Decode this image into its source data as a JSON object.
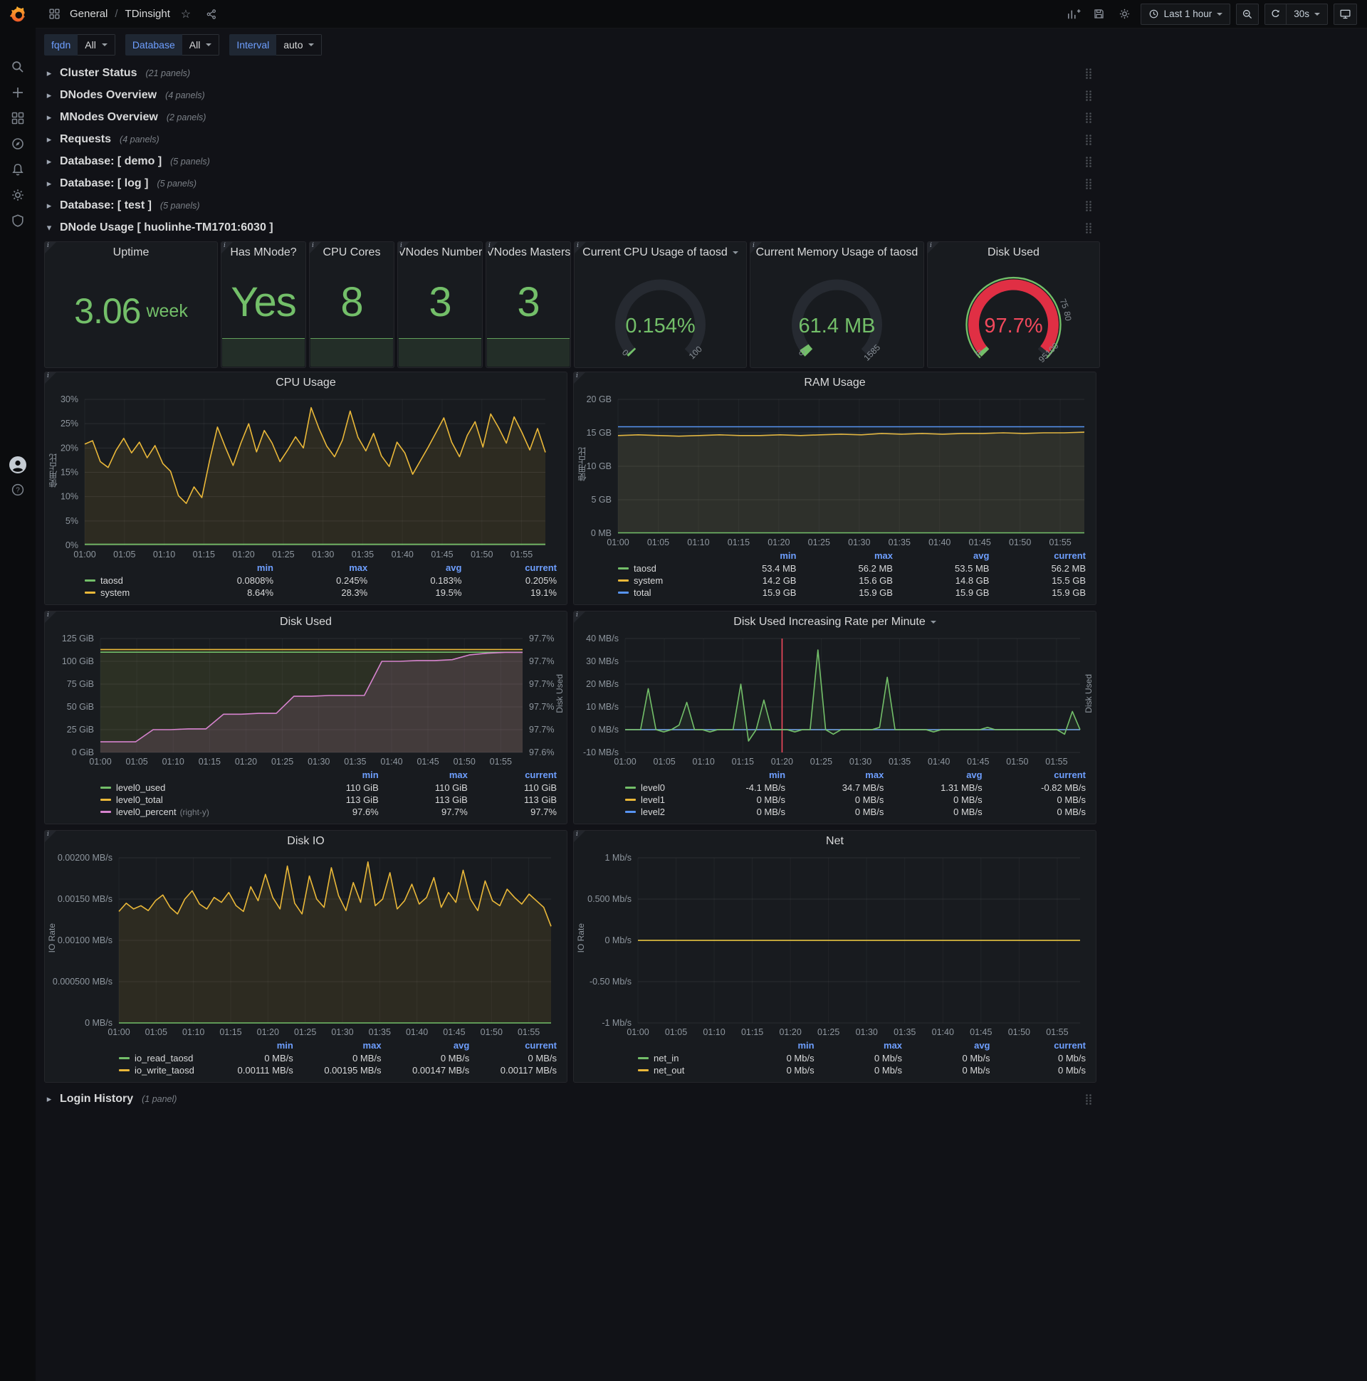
{
  "topbar": {
    "section": "General",
    "separator": "/",
    "page": "TDinsight",
    "time_range": "Last 1 hour",
    "refresh": "30s"
  },
  "variables": [
    {
      "label": "fqdn",
      "value": "All"
    },
    {
      "label": "Database",
      "value": "All"
    },
    {
      "label": "Interval",
      "value": "auto"
    }
  ],
  "rows": [
    {
      "title": "Cluster Status",
      "count": "(21 panels)"
    },
    {
      "title": "DNodes Overview",
      "count": "(4 panels)"
    },
    {
      "title": "MNodes Overview",
      "count": "(2 panels)"
    },
    {
      "title": "Requests",
      "count": "(4 panels)"
    },
    {
      "title": "Database: [ demo ]",
      "count": "(5 panels)"
    },
    {
      "title": "Database: [ log ]",
      "count": "(5 panels)"
    },
    {
      "title": "Database: [ test ]",
      "count": "(5 panels)"
    }
  ],
  "dnode_row": {
    "title": "DNode Usage [ huolinhe-TM1701:6030 ]"
  },
  "login_row": {
    "title": "Login History",
    "count": "(1 panel)"
  },
  "stats": [
    {
      "id": "uptime",
      "title": "Uptime",
      "value": "3.06",
      "suffix": "week",
      "sparkline": false
    },
    {
      "id": "has-mnode",
      "title": "Has MNode?",
      "value": "Yes",
      "suffix": "",
      "sparkline": true
    },
    {
      "id": "cpu-cores",
      "title": "CPU Cores",
      "value": "8",
      "suffix": "",
      "sparkline": true
    },
    {
      "id": "vnodes-number",
      "title": "VNodes Number",
      "value": "3",
      "suffix": "",
      "sparkline": true
    },
    {
      "id": "vnodes-masters",
      "title": "VNodes Masters",
      "value": "3",
      "suffix": "",
      "sparkline": true
    }
  ],
  "gauges": [
    {
      "id": "cpu-usage",
      "title": "Current CPU Usage of taosd",
      "caret": true,
      "value": "0.154%",
      "fraction": 0.00154,
      "min": "0",
      "max": "100",
      "color": "#73bf69",
      "thresholds": []
    },
    {
      "id": "mem-usage",
      "title": "Current Memory Usage of taosd",
      "caret": false,
      "value": "61.4 MB",
      "fraction": 0.0387,
      "min": "0",
      "max": "1585",
      "color": "#73bf69",
      "thresholds": []
    },
    {
      "id": "disk-used",
      "title": "Disk Used",
      "caret": false,
      "value": "97.7%",
      "fraction": 0.977,
      "min": "0",
      "max": "95100",
      "color": "#e02f44",
      "value_color": "#f2495c",
      "outer_ring": "#73bf69",
      "start_sliver": "#73bf69",
      "thresholds": [
        {
          "f": 0.75,
          "label": "75"
        },
        {
          "f": 0.8,
          "label": "80"
        }
      ]
    }
  ],
  "xticks": [
    "01:00",
    "01:05",
    "01:10",
    "01:15",
    "01:20",
    "01:25",
    "01:30",
    "01:35",
    "01:40",
    "01:45",
    "01:50",
    "01:55"
  ],
  "charts": [
    {
      "id": "cpu",
      "title": "CPU Usage",
      "caret": false,
      "ylabel": "使用占比",
      "ymin": 0,
      "ymax": 30,
      "yticks": [
        {
          "v": 0,
          "t": "0%"
        },
        {
          "v": 5,
          "t": "5%"
        },
        {
          "v": 10,
          "t": "10%"
        },
        {
          "v": 15,
          "t": "15%"
        },
        {
          "v": 20,
          "t": "20%"
        },
        {
          "v": 25,
          "t": "25%"
        },
        {
          "v": 30,
          "t": "30%"
        }
      ],
      "series": [
        {
          "name": "system",
          "color": "#eab839",
          "fill": 0.1,
          "data": [
            20.8,
            21.5,
            17.2,
            16.0,
            19.5,
            22.0,
            19.0,
            21.2,
            18.0,
            20.5,
            16.8,
            15.2,
            10.2,
            8.6,
            12.0,
            9.8,
            17.5,
            24.3,
            20.2,
            16.4,
            21.0,
            25.0,
            19.2,
            23.6,
            21.0,
            17.2,
            19.6,
            22.3,
            20.0,
            28.3,
            24.0,
            20.4,
            18.2,
            21.6,
            27.6,
            22.2,
            19.4,
            23.0,
            18.4,
            16.2,
            21.2,
            19.0,
            14.6,
            17.4,
            20.2,
            23.2,
            26.2,
            21.2,
            18.2,
            22.6,
            25.4,
            20.2,
            27.0,
            24.2,
            21.0,
            26.4,
            23.2,
            19.6,
            24.0,
            19.1
          ]
        },
        {
          "name": "taosd",
          "color": "#73bf69",
          "fill": 0.18,
          "data": [
            0.2,
            0.2
          ]
        }
      ],
      "legend": {
        "cols": [
          "min",
          "max",
          "avg",
          "current"
        ],
        "rows": [
          {
            "name": "taosd",
            "color": "#73bf69",
            "values": [
              "0.0808%",
              "0.245%",
              "0.183%",
              "0.205%"
            ]
          },
          {
            "name": "system",
            "color": "#eab839",
            "values": [
              "8.64%",
              "28.3%",
              "19.5%",
              "19.1%"
            ]
          }
        ]
      }
    },
    {
      "id": "ram",
      "title": "RAM Usage",
      "caret": false,
      "ylabel": "使用占比",
      "ymin": 0,
      "ymax": 20,
      "yticks": [
        {
          "v": 0,
          "t": "0 MB"
        },
        {
          "v": 5,
          "t": "5 GB"
        },
        {
          "v": 10,
          "t": "10 GB"
        },
        {
          "v": 15,
          "t": "15 GB"
        },
        {
          "v": 20,
          "t": "20 GB"
        }
      ],
      "series": [
        {
          "name": "system",
          "color": "#eab839",
          "fill": 0.1,
          "data": [
            14.6,
            14.7,
            14.6,
            14.5,
            14.6,
            14.7,
            14.6,
            14.6,
            14.7,
            14.6,
            14.7,
            14.8,
            14.7,
            14.9,
            14.8,
            14.9,
            14.8,
            14.9,
            14.9,
            15.0,
            14.9,
            15.0,
            15.0,
            15.1
          ]
        },
        {
          "name": "total",
          "color": "#5794f2",
          "fill": 0.05,
          "data": [
            15.9,
            15.9
          ]
        },
        {
          "name": "taosd",
          "color": "#73bf69",
          "fill": 0.15,
          "data": [
            0.055,
            0.055
          ]
        }
      ],
      "legend": {
        "cols": [
          "min",
          "max",
          "avg",
          "current"
        ],
        "rows": [
          {
            "name": "taosd",
            "color": "#73bf69",
            "values": [
              "53.4 MB",
              "56.2 MB",
              "53.5 MB",
              "56.2 MB"
            ]
          },
          {
            "name": "system",
            "color": "#eab839",
            "values": [
              "14.2 GB",
              "15.6 GB",
              "14.8 GB",
              "15.5 GB"
            ]
          },
          {
            "name": "total",
            "color": "#5794f2",
            "values": [
              "15.9 GB",
              "15.9 GB",
              "15.9 GB",
              "15.9 GB"
            ]
          }
        ]
      }
    },
    {
      "id": "disk",
      "title": "Disk Used",
      "caret": false,
      "right_label": "Disk Used",
      "ymin": 0,
      "ymax": 125,
      "yticks": [
        {
          "v": 0,
          "t": "0 GiB"
        },
        {
          "v": 25,
          "t": "25 GiB"
        },
        {
          "v": 50,
          "t": "50 GiB"
        },
        {
          "v": 75,
          "t": "75 GiB"
        },
        {
          "v": 100,
          "t": "100 GiB"
        },
        {
          "v": 125,
          "t": "125 GiB"
        }
      ],
      "right": {
        "min": 97.58,
        "max": 97.72,
        "ticks": [
          "97.6%",
          "97.7%",
          "97.7%",
          "97.7%",
          "97.7%",
          "97.7%"
        ]
      },
      "series": [
        {
          "name": "level0_total",
          "color": "#eab839",
          "fill": 0.07,
          "data": [
            113,
            113
          ]
        },
        {
          "name": "level0_used",
          "color": "#73bf69",
          "fill": 0.07,
          "data": [
            110,
            110
          ]
        },
        {
          "name": "level0_percent",
          "color": "#d683ce",
          "axis": "right",
          "fill": 0.14,
          "data": [
            97.593,
            97.593,
            97.593,
            97.608,
            97.608,
            97.609,
            97.609,
            97.627,
            97.627,
            97.628,
            97.628,
            97.649,
            97.649,
            97.65,
            97.65,
            97.65,
            97.692,
            97.692,
            97.693,
            97.693,
            97.694,
            97.7,
            97.702,
            97.703,
            97.703
          ]
        }
      ],
      "legend": {
        "cols": [
          "min",
          "max",
          "current"
        ],
        "rows": [
          {
            "name": "level0_used",
            "color": "#73bf69",
            "values": [
              "110 GiB",
              "110 GiB",
              "110 GiB"
            ]
          },
          {
            "name": "level0_total",
            "color": "#eab839",
            "values": [
              "113 GiB",
              "113 GiB",
              "113 GiB"
            ]
          },
          {
            "name": "level0_percent",
            "suffix": "(right-y)",
            "color": "#d683ce",
            "values": [
              "97.6%",
              "97.7%",
              "97.7%"
            ]
          }
        ]
      }
    },
    {
      "id": "rate",
      "title": "Disk Used Increasing Rate per Minute",
      "caret": true,
      "right_label": "Disk Used",
      "ymin": -10,
      "ymax": 40,
      "annotation_frac": 0.345,
      "yticks": [
        {
          "v": -10,
          "t": "-10 MB/s"
        },
        {
          "v": 0,
          "t": "0 MB/s"
        },
        {
          "v": 10,
          "t": "10 MB/s"
        },
        {
          "v": 20,
          "t": "20 MB/s"
        },
        {
          "v": 30,
          "t": "30 MB/s"
        },
        {
          "v": 40,
          "t": "40 MB/s"
        }
      ],
      "series": [
        {
          "name": "level1",
          "color": "#eab839",
          "data": [
            0,
            0
          ]
        },
        {
          "name": "level2",
          "color": "#5794f2",
          "data": [
            0,
            0
          ]
        },
        {
          "name": "level0",
          "color": "#73bf69",
          "fill": 0.08,
          "data": [
            0,
            0,
            0,
            18,
            0,
            -1,
            0,
            2,
            12,
            0,
            0,
            -1,
            0,
            0,
            0,
            20,
            -5,
            0,
            13,
            0,
            0,
            0,
            -1,
            0,
            0,
            35,
            0,
            -2,
            0,
            0,
            0,
            0,
            0,
            1,
            23,
            0,
            0,
            0,
            0,
            0,
            -1,
            0,
            0,
            0,
            0,
            0,
            0,
            1,
            0,
            0,
            0,
            0,
            0,
            0,
            0,
            0,
            0,
            -2,
            8,
            0
          ]
        }
      ],
      "legend": {
        "cols": [
          "min",
          "max",
          "avg",
          "current"
        ],
        "rows": [
          {
            "name": "level0",
            "color": "#73bf69",
            "values": [
              "-4.1 MB/s",
              "34.7 MB/s",
              "1.31 MB/s",
              "-0.82 MB/s"
            ]
          },
          {
            "name": "level1",
            "color": "#eab839",
            "values": [
              "0 MB/s",
              "0 MB/s",
              "0 MB/s",
              "0 MB/s"
            ]
          },
          {
            "name": "level2",
            "color": "#5794f2",
            "values": [
              "0 MB/s",
              "0 MB/s",
              "0 MB/s",
              "0 MB/s"
            ]
          }
        ]
      }
    },
    {
      "id": "diskio",
      "title": "Disk IO",
      "caret": false,
      "ylabel": "IO Rate",
      "ymin": 0,
      "ymax": 0.002,
      "yticks": [
        {
          "v": 0,
          "t": "0 MB/s"
        },
        {
          "v": 0.0005,
          "t": "0.000500 MB/s"
        },
        {
          "v": 0.001,
          "t": "0.00100 MB/s"
        },
        {
          "v": 0.0015,
          "t": "0.00150 MB/s"
        },
        {
          "v": 0.002,
          "t": "0.00200 MB/s"
        }
      ],
      "series": [
        {
          "name": "io_write_taosd",
          "color": "#eab839",
          "fill": 0.1,
          "data": [
            0.00135,
            0.00145,
            0.00138,
            0.00142,
            0.00136,
            0.00148,
            0.00155,
            0.0014,
            0.00132,
            0.0015,
            0.0016,
            0.00144,
            0.00138,
            0.00152,
            0.00146,
            0.00158,
            0.00142,
            0.00135,
            0.00165,
            0.00148,
            0.0018,
            0.00152,
            0.00138,
            0.0019,
            0.00145,
            0.00132,
            0.00178,
            0.0015,
            0.0014,
            0.00188,
            0.00154,
            0.00136,
            0.0017,
            0.00146,
            0.00195,
            0.00142,
            0.0015,
            0.00182,
            0.00138,
            0.00148,
            0.00168,
            0.00144,
            0.00152,
            0.00176,
            0.0014,
            0.00158,
            0.00146,
            0.00185,
            0.0015,
            0.00136,
            0.00172,
            0.00148,
            0.00142,
            0.00162,
            0.00152,
            0.00144,
            0.00156,
            0.00148,
            0.0014,
            0.00117
          ]
        },
        {
          "name": "io_read_taosd",
          "color": "#73bf69",
          "data": [
            0,
            0
          ]
        }
      ],
      "legend": {
        "cols": [
          "min",
          "max",
          "avg",
          "current"
        ],
        "rows": [
          {
            "name": "io_read_taosd",
            "color": "#73bf69",
            "values": [
              "0 MB/s",
              "0 MB/s",
              "0 MB/s",
              "0 MB/s"
            ]
          },
          {
            "name": "io_write_taosd",
            "color": "#eab839",
            "values": [
              "0.00111 MB/s",
              "0.00195 MB/s",
              "0.00147 MB/s",
              "0.00117 MB/s"
            ]
          }
        ]
      }
    },
    {
      "id": "net",
      "title": "Net",
      "caret": false,
      "ylabel": "IO Rate",
      "ymin": -1,
      "ymax": 1,
      "yticks": [
        {
          "v": -1,
          "t": "-1 Mb/s"
        },
        {
          "v": -0.5,
          "t": "-0.50 Mb/s"
        },
        {
          "v": 0,
          "t": "0 Mb/s"
        },
        {
          "v": 0.5,
          "t": "0.500 Mb/s"
        },
        {
          "v": 1,
          "t": "1 Mb/s"
        }
      ],
      "series": [
        {
          "name": "net_in",
          "color": "#73bf69",
          "data": [
            0,
            0
          ]
        },
        {
          "name": "net_out",
          "color": "#eab839",
          "data": [
            0,
            0
          ]
        }
      ],
      "legend": {
        "cols": [
          "min",
          "max",
          "avg",
          "current"
        ],
        "rows": [
          {
            "name": "net_in",
            "color": "#73bf69",
            "values": [
              "0 Mb/s",
              "0 Mb/s",
              "0 Mb/s",
              "0 Mb/s"
            ]
          },
          {
            "name": "net_out",
            "color": "#eab839",
            "values": [
              "0 Mb/s",
              "0 Mb/s",
              "0 Mb/s",
              "0 Mb/s"
            ]
          }
        ]
      }
    }
  ]
}
